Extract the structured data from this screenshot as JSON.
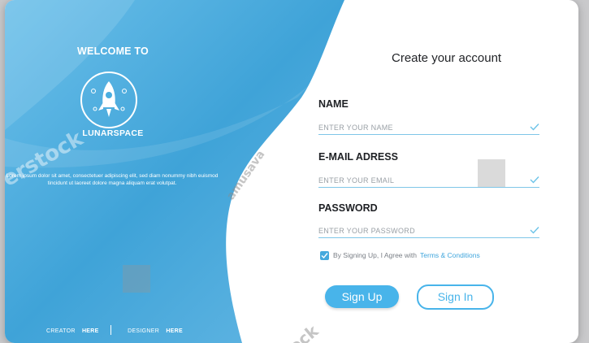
{
  "left_panel": {
    "welcome": "WELCOME TO",
    "brand": "LUNARSPACE",
    "description": "Lorem ipsum dolor sit amet, consectetuer adipiscing elit, sed diam nonummy nibh euismod tincidunt ut laoreet dolore magna aliquam erat volutpat.",
    "creator_prefix": "CREATOR",
    "creator_link": "HERE",
    "designer_prefix": "DESIGNER",
    "designer_link": "HERE"
  },
  "form": {
    "title": "Create your account",
    "name_label": "NAME",
    "name_placeholder": "ENTER YOUR NAME",
    "email_label": "E-MAIL ADRESS",
    "email_placeholder": "ENTER YOUR EMAIL",
    "password_label": "PASSWORD",
    "password_placeholder": "ENTER YOUR PASSWORD",
    "consent_text": "By Signing Up, I Agree with",
    "terms_link": "Terms & Conditions",
    "signup_label": "Sign Up",
    "signin_label": "Sign In"
  },
  "watermarks": {
    "left": "erstock",
    "middle": "amusava",
    "bottom": "ock"
  },
  "colors": {
    "accent": "#48b4ea",
    "panel_dark": "#3a9fd4",
    "panel_light": "#62bae6",
    "text_dark": "#1e2024"
  }
}
